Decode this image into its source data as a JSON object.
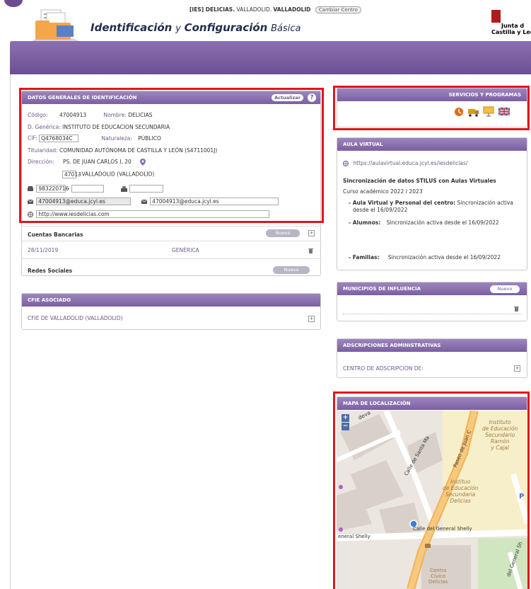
{
  "header": {
    "center_prefix": "[IES] DELICIAS.",
    "center_location": "VALLADOLID.",
    "center_city": "VALLADOLID",
    "change_center": "Cambiar Centro",
    "title_part1": "Identificación",
    "title_part2": "y",
    "title_part3": "Configuración",
    "title_part4": "Básica",
    "logo_line1": "Junta d",
    "logo_line2": "Castilla y León"
  },
  "general": {
    "title": "DATOS GENERALES DE IDENTIFICACIÓN",
    "update_btn": "Actualizar",
    "help": "?",
    "codigo_label": "Código:",
    "codigo_value": "47004913",
    "nombre_label": "Nombre:",
    "nombre_value": "DELICIAS",
    "generica_label": "D. Genérica:",
    "generica_value": "INSTITUTO DE EDUCACION SECUNDARIA",
    "cif_label": "CIF:",
    "cif_value": "Q4768034C",
    "naturaleza_label": "Naturaleza:",
    "naturaleza_value": "PÚBLICO",
    "titularidad_label": "Titularidad:",
    "titularidad_value": "COMUNIDAD AUTÓNOMA DE CASTILLA Y LEÓN (S4711001J)",
    "direccion_label": "Dirección:",
    "direccion_value": "PS. DE JUAN CARLOS I, 20",
    "cp_value": "47013",
    "localidad_value": "- VALLADOLID (VALLADOLID)",
    "phone_value": "983220716",
    "phone_sep": "-",
    "email1_value": "47004913@educa.jcyl.es",
    "email2_value": "47004913@educa.jcyl.es",
    "web_value": "http://www.iesdelicias.com"
  },
  "bank": {
    "title": "Cuentas Bancarias",
    "new_btn": "Nueva",
    "date": "28/11/2019",
    "type": "GENÉRICA"
  },
  "social": {
    "title": "Redes Sociales",
    "new_btn": "Nueva"
  },
  "cfie": {
    "title": "CFIE ASOCIADO",
    "value": "CFIE DE VALLADOLID (VALLADOLID)"
  },
  "services": {
    "title": "SERVICIOS Y PROGRAMAS"
  },
  "aula": {
    "title": "AULA VIRTUAL",
    "url": "https://aulavirtual.educa.jcyl.es/iesdelicias/",
    "sync_title": "Sincronización de datos STILUS con Aulas Virtuales",
    "course": "Curso académico 2022 / 2023",
    "staff_label": "- Aula Virtual y Personal del centro:",
    "staff_status_1": "Sincronización activa",
    "staff_status_2": "desde el 16/09/2022",
    "students_label": "- Alumnos:",
    "students_status": "Sincronización activa desde el 16/09/2022",
    "families_label": "- Familias:",
    "families_status": "Sincronización activa desde el 16/09/2022"
  },
  "municipios": {
    "title": "MUNICIPIOS DE INFLUENCIA",
    "new_btn": "Nuevo"
  },
  "adscripciones": {
    "title": "ADSCRIPCIONES ADMINISTRATIVAS",
    "value": "CENTRO DE ADSCRIPCIÓN DE:"
  },
  "map": {
    "title": "MAPA DE LOCALIZACIÓN",
    "zoom_in": "+",
    "zoom_out": "−",
    "street_1": "Calle de Santa Ma",
    "street_2": "Paseo de Juan C",
    "street_3": "Calle del General Shelly",
    "street_4": "eneral Shelly",
    "street_5": "del General Sh",
    "poi_1_l1": "Instituto",
    "poi_1_l2": "de Educación",
    "poi_1_l3": "Secundario",
    "poi_1_l4": "Ramón",
    "poi_1_l5": "y Cajal",
    "poi_2_l1": "Instituo",
    "poi_2_l2": "de Educación",
    "poi_2_l3": "Secundaria",
    "poi_2_l4": "Delicias",
    "poi_3_l1": "Centro",
    "poi_3_l2": "Cívico",
    "poi_3_l3": "Delicias",
    "street_top": "deva",
    "parking": "P"
  }
}
